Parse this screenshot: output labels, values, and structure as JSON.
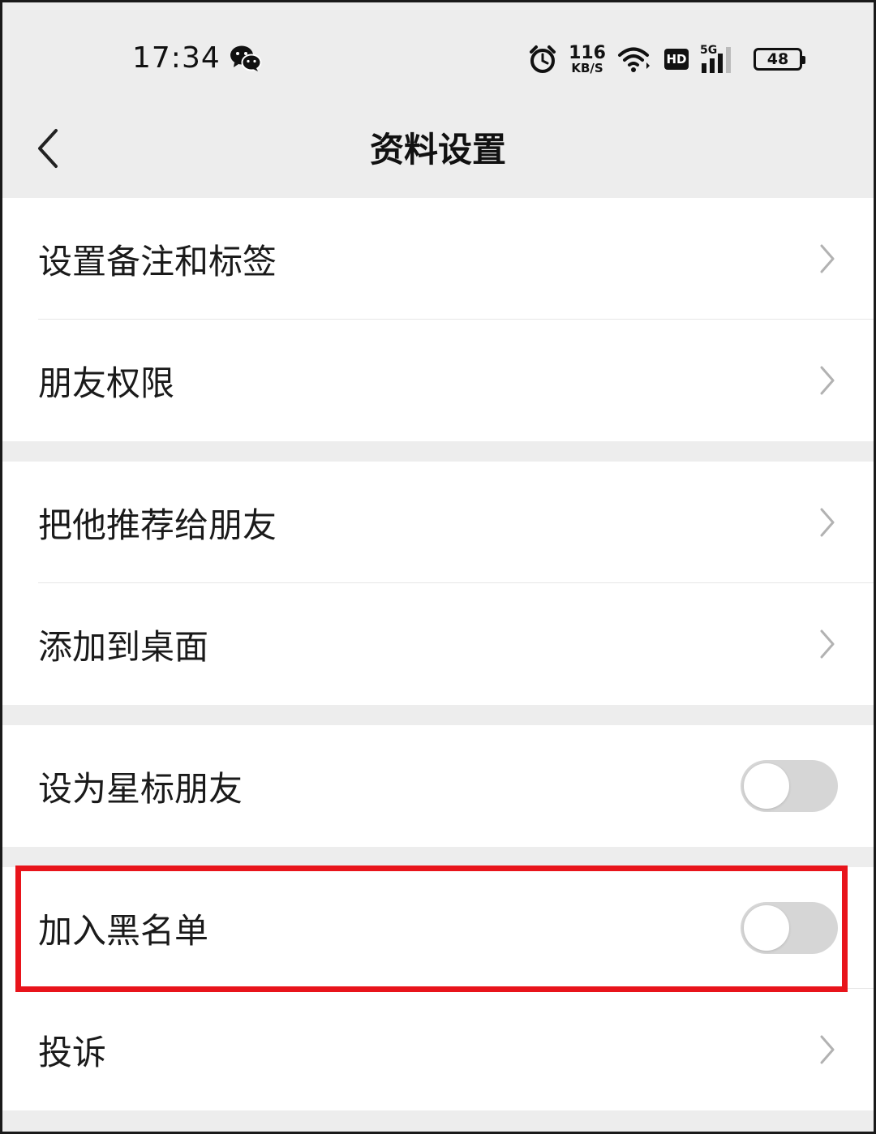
{
  "status_bar": {
    "time": "17:34",
    "app_icon": "wechat-icon",
    "net_speed": "116",
    "net_speed_unit": "KB/S",
    "hd": "HD",
    "network_type": "5G",
    "battery": "48"
  },
  "nav": {
    "back_icon": "chevron-left-icon",
    "title": "资料设置"
  },
  "groups": [
    {
      "rows": [
        {
          "label": "设置备注和标签",
          "control": "chevron"
        },
        {
          "label": "朋友权限",
          "control": "chevron"
        }
      ]
    },
    {
      "rows": [
        {
          "label": "把他推荐给朋友",
          "control": "chevron"
        },
        {
          "label": "添加到桌面",
          "control": "chevron"
        }
      ]
    },
    {
      "rows": [
        {
          "label": "设为星标朋友",
          "control": "toggle",
          "on": false
        }
      ]
    },
    {
      "rows": [
        {
          "label": "加入黑名单",
          "control": "toggle",
          "on": false
        },
        {
          "label": "投诉",
          "control": "chevron"
        }
      ]
    }
  ],
  "colors": {
    "page_bg": "#ededed",
    "row_bg": "#ffffff",
    "toggle_off": "#d6d6d6",
    "highlight": "#e8141b"
  }
}
